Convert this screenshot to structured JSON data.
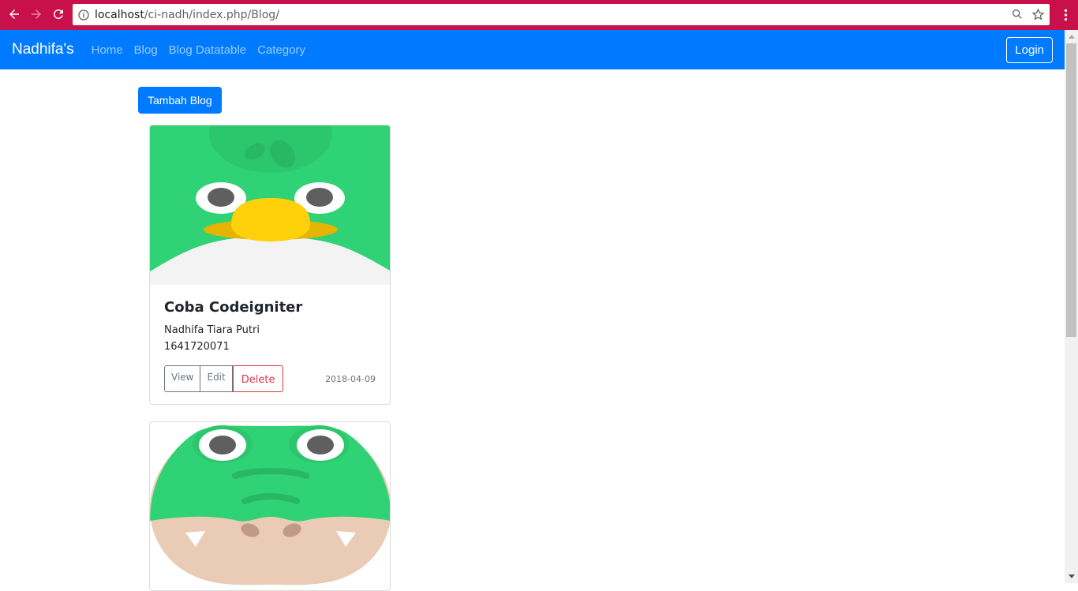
{
  "browser": {
    "url_host": "localhost",
    "url_path": "/ci-nadh/index.php/Blog/",
    "theme_color": "#c8104a"
  },
  "navbar": {
    "brand": "Nadhifa's",
    "links": [
      "Home",
      "Blog",
      "Blog Datatable",
      "Category"
    ],
    "login_label": "Login",
    "color": "#007bff"
  },
  "main": {
    "add_button_label": "Tambah Blog",
    "cards": [
      {
        "image": "green-bird-avatar",
        "title": "Coba Codeigniter",
        "author": "Nadhifa Tiara Putri",
        "nim": "1641720071",
        "view_label": "View",
        "edit_label": "Edit",
        "delete_label": "Delete",
        "date": "2018-04-09"
      },
      {
        "image": "green-crocodile-avatar"
      }
    ]
  }
}
